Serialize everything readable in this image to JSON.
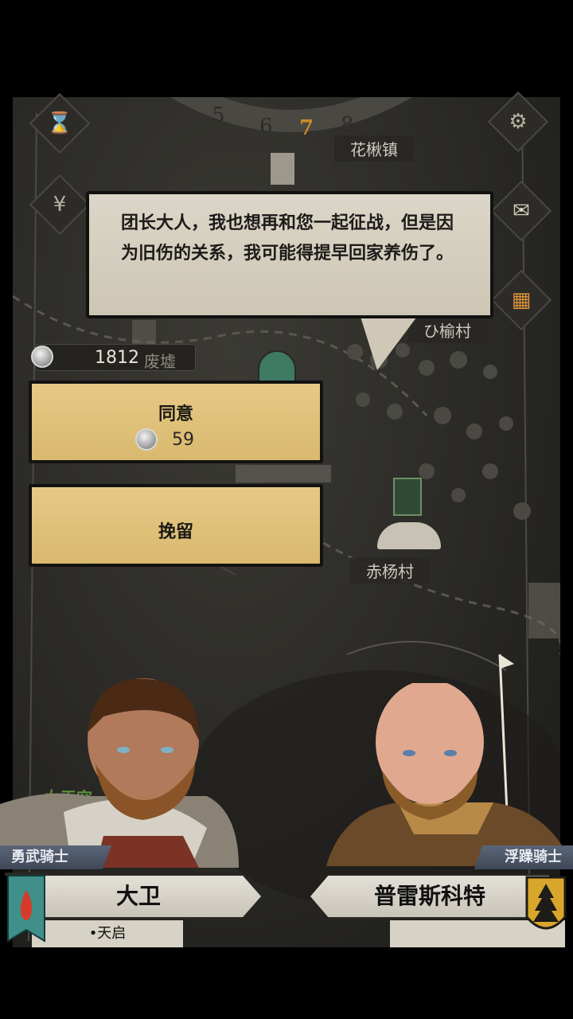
{
  "dialog": {
    "text": "团长大人，我也想再和您一起征战，但是因为旧伤的关系，我可能得提早回家养伤了。"
  },
  "calendar_dial": {
    "numbers": [
      "5",
      "6",
      "7",
      "8"
    ],
    "active": "7"
  },
  "map": {
    "places": [
      {
        "name": "花楸镇"
      },
      {
        "name": "ひ榆村"
      },
      {
        "name": "赤杨村"
      },
      {
        "name": "女王空"
      }
    ]
  },
  "currency": {
    "amount": "1812",
    "suffix": "废墟",
    "icon": "silver-coin-icon"
  },
  "choices": [
    {
      "label": "同意",
      "cost": "59",
      "cost_icon": "silver-coin-icon"
    },
    {
      "label": "挽留"
    }
  ],
  "side_buttons": {
    "left": [
      "hourglass-icon",
      "money-bag-icon"
    ],
    "right": [
      "gear-icon",
      "envelope-icon",
      "window-icon"
    ]
  },
  "characters": {
    "left": {
      "rank": "勇武骑士",
      "name": "大卫",
      "trait": "•天启",
      "banner": "red-flame-banner"
    },
    "right": {
      "rank": "浮躁骑士",
      "name": "普雷斯科特",
      "banner": "pine-tree-shield"
    }
  },
  "colors": {
    "choice_bg": "#e2c27c",
    "bubble_bg": "#d6d0c1",
    "dial_active": "#c98a2a",
    "rank_plate": "#4c5768"
  }
}
